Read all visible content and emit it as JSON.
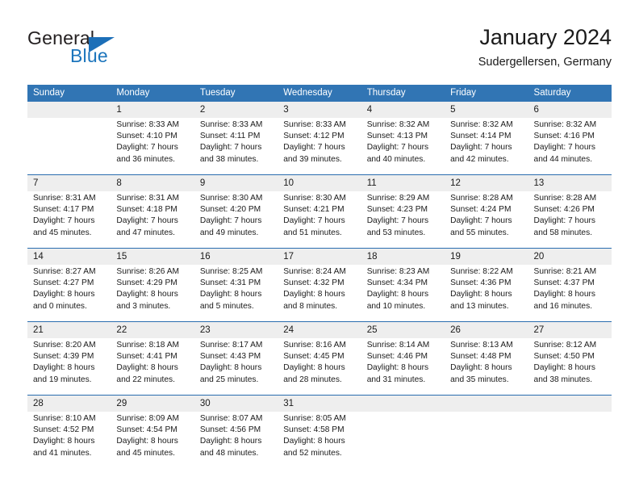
{
  "brand": {
    "name_part1": "General",
    "name_part2": "Blue",
    "triangle_icon": "triangle-icon",
    "accent_color": "#1c75bc"
  },
  "header": {
    "title": "January 2024",
    "subtitle": "Sudergellersen, Germany"
  },
  "calendar": {
    "header_color": "#3175b4",
    "row_band_color": "#eeeeee",
    "weekdays": [
      "Sunday",
      "Monday",
      "Tuesday",
      "Wednesday",
      "Thursday",
      "Friday",
      "Saturday"
    ],
    "weeks": [
      [
        {
          "day": "",
          "sunrise": "",
          "sunset": "",
          "daylight1": "",
          "daylight2": ""
        },
        {
          "day": "1",
          "sunrise": "Sunrise: 8:33 AM",
          "sunset": "Sunset: 4:10 PM",
          "daylight1": "Daylight: 7 hours",
          "daylight2": "and 36 minutes."
        },
        {
          "day": "2",
          "sunrise": "Sunrise: 8:33 AM",
          "sunset": "Sunset: 4:11 PM",
          "daylight1": "Daylight: 7 hours",
          "daylight2": "and 38 minutes."
        },
        {
          "day": "3",
          "sunrise": "Sunrise: 8:33 AM",
          "sunset": "Sunset: 4:12 PM",
          "daylight1": "Daylight: 7 hours",
          "daylight2": "and 39 minutes."
        },
        {
          "day": "4",
          "sunrise": "Sunrise: 8:32 AM",
          "sunset": "Sunset: 4:13 PM",
          "daylight1": "Daylight: 7 hours",
          "daylight2": "and 40 minutes."
        },
        {
          "day": "5",
          "sunrise": "Sunrise: 8:32 AM",
          "sunset": "Sunset: 4:14 PM",
          "daylight1": "Daylight: 7 hours",
          "daylight2": "and 42 minutes."
        },
        {
          "day": "6",
          "sunrise": "Sunrise: 8:32 AM",
          "sunset": "Sunset: 4:16 PM",
          "daylight1": "Daylight: 7 hours",
          "daylight2": "and 44 minutes."
        }
      ],
      [
        {
          "day": "7",
          "sunrise": "Sunrise: 8:31 AM",
          "sunset": "Sunset: 4:17 PM",
          "daylight1": "Daylight: 7 hours",
          "daylight2": "and 45 minutes."
        },
        {
          "day": "8",
          "sunrise": "Sunrise: 8:31 AM",
          "sunset": "Sunset: 4:18 PM",
          "daylight1": "Daylight: 7 hours",
          "daylight2": "and 47 minutes."
        },
        {
          "day": "9",
          "sunrise": "Sunrise: 8:30 AM",
          "sunset": "Sunset: 4:20 PM",
          "daylight1": "Daylight: 7 hours",
          "daylight2": "and 49 minutes."
        },
        {
          "day": "10",
          "sunrise": "Sunrise: 8:30 AM",
          "sunset": "Sunset: 4:21 PM",
          "daylight1": "Daylight: 7 hours",
          "daylight2": "and 51 minutes."
        },
        {
          "day": "11",
          "sunrise": "Sunrise: 8:29 AM",
          "sunset": "Sunset: 4:23 PM",
          "daylight1": "Daylight: 7 hours",
          "daylight2": "and 53 minutes."
        },
        {
          "day": "12",
          "sunrise": "Sunrise: 8:28 AM",
          "sunset": "Sunset: 4:24 PM",
          "daylight1": "Daylight: 7 hours",
          "daylight2": "and 55 minutes."
        },
        {
          "day": "13",
          "sunrise": "Sunrise: 8:28 AM",
          "sunset": "Sunset: 4:26 PM",
          "daylight1": "Daylight: 7 hours",
          "daylight2": "and 58 minutes."
        }
      ],
      [
        {
          "day": "14",
          "sunrise": "Sunrise: 8:27 AM",
          "sunset": "Sunset: 4:27 PM",
          "daylight1": "Daylight: 8 hours",
          "daylight2": "and 0 minutes."
        },
        {
          "day": "15",
          "sunrise": "Sunrise: 8:26 AM",
          "sunset": "Sunset: 4:29 PM",
          "daylight1": "Daylight: 8 hours",
          "daylight2": "and 3 minutes."
        },
        {
          "day": "16",
          "sunrise": "Sunrise: 8:25 AM",
          "sunset": "Sunset: 4:31 PM",
          "daylight1": "Daylight: 8 hours",
          "daylight2": "and 5 minutes."
        },
        {
          "day": "17",
          "sunrise": "Sunrise: 8:24 AM",
          "sunset": "Sunset: 4:32 PM",
          "daylight1": "Daylight: 8 hours",
          "daylight2": "and 8 minutes."
        },
        {
          "day": "18",
          "sunrise": "Sunrise: 8:23 AM",
          "sunset": "Sunset: 4:34 PM",
          "daylight1": "Daylight: 8 hours",
          "daylight2": "and 10 minutes."
        },
        {
          "day": "19",
          "sunrise": "Sunrise: 8:22 AM",
          "sunset": "Sunset: 4:36 PM",
          "daylight1": "Daylight: 8 hours",
          "daylight2": "and 13 minutes."
        },
        {
          "day": "20",
          "sunrise": "Sunrise: 8:21 AM",
          "sunset": "Sunset: 4:37 PM",
          "daylight1": "Daylight: 8 hours",
          "daylight2": "and 16 minutes."
        }
      ],
      [
        {
          "day": "21",
          "sunrise": "Sunrise: 8:20 AM",
          "sunset": "Sunset: 4:39 PM",
          "daylight1": "Daylight: 8 hours",
          "daylight2": "and 19 minutes."
        },
        {
          "day": "22",
          "sunrise": "Sunrise: 8:18 AM",
          "sunset": "Sunset: 4:41 PM",
          "daylight1": "Daylight: 8 hours",
          "daylight2": "and 22 minutes."
        },
        {
          "day": "23",
          "sunrise": "Sunrise: 8:17 AM",
          "sunset": "Sunset: 4:43 PM",
          "daylight1": "Daylight: 8 hours",
          "daylight2": "and 25 minutes."
        },
        {
          "day": "24",
          "sunrise": "Sunrise: 8:16 AM",
          "sunset": "Sunset: 4:45 PM",
          "daylight1": "Daylight: 8 hours",
          "daylight2": "and 28 minutes."
        },
        {
          "day": "25",
          "sunrise": "Sunrise: 8:14 AM",
          "sunset": "Sunset: 4:46 PM",
          "daylight1": "Daylight: 8 hours",
          "daylight2": "and 31 minutes."
        },
        {
          "day": "26",
          "sunrise": "Sunrise: 8:13 AM",
          "sunset": "Sunset: 4:48 PM",
          "daylight1": "Daylight: 8 hours",
          "daylight2": "and 35 minutes."
        },
        {
          "day": "27",
          "sunrise": "Sunrise: 8:12 AM",
          "sunset": "Sunset: 4:50 PM",
          "daylight1": "Daylight: 8 hours",
          "daylight2": "and 38 minutes."
        }
      ],
      [
        {
          "day": "28",
          "sunrise": "Sunrise: 8:10 AM",
          "sunset": "Sunset: 4:52 PM",
          "daylight1": "Daylight: 8 hours",
          "daylight2": "and 41 minutes."
        },
        {
          "day": "29",
          "sunrise": "Sunrise: 8:09 AM",
          "sunset": "Sunset: 4:54 PM",
          "daylight1": "Daylight: 8 hours",
          "daylight2": "and 45 minutes."
        },
        {
          "day": "30",
          "sunrise": "Sunrise: 8:07 AM",
          "sunset": "Sunset: 4:56 PM",
          "daylight1": "Daylight: 8 hours",
          "daylight2": "and 48 minutes."
        },
        {
          "day": "31",
          "sunrise": "Sunrise: 8:05 AM",
          "sunset": "Sunset: 4:58 PM",
          "daylight1": "Daylight: 8 hours",
          "daylight2": "and 52 minutes."
        },
        {
          "day": "",
          "sunrise": "",
          "sunset": "",
          "daylight1": "",
          "daylight2": ""
        },
        {
          "day": "",
          "sunrise": "",
          "sunset": "",
          "daylight1": "",
          "daylight2": ""
        },
        {
          "day": "",
          "sunrise": "",
          "sunset": "",
          "daylight1": "",
          "daylight2": ""
        }
      ]
    ]
  }
}
